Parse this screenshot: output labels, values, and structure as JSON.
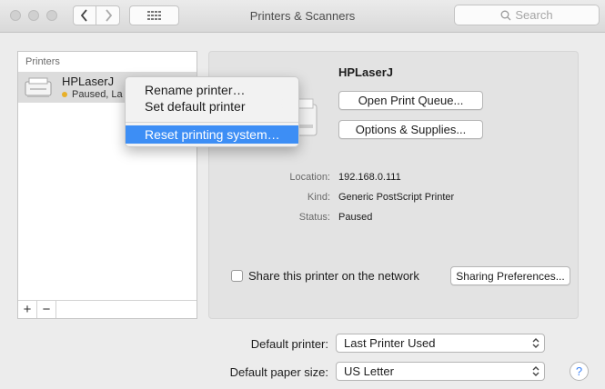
{
  "window": {
    "title": "Printers & Scanners",
    "search_placeholder": "Search"
  },
  "printers": {
    "header": "Printers",
    "items": [
      {
        "name": "HPLaserJ",
        "status": "Paused, La",
        "status_color": "#e8b028"
      }
    ],
    "add_label": "+",
    "remove_label": "−"
  },
  "context_menu": {
    "items": [
      {
        "label": "Rename printer…"
      },
      {
        "label": "Set default printer"
      },
      {
        "label": "Reset printing system…",
        "highlighted": true
      }
    ],
    "highlight_color": "#3d8ef5"
  },
  "detail": {
    "printer_name": "HPLaserJ",
    "open_queue_label": "Open Print Queue...",
    "options_label": "Options & Supplies...",
    "location_label": "Location:",
    "location_value": "192.168.0.111",
    "kind_label": "Kind:",
    "kind_value": "Generic PostScript Printer",
    "status_label": "Status:",
    "status_value": "Paused",
    "share_label": "Share this printer on the network",
    "share_checked": false,
    "sharing_prefs_label": "Sharing Preferences..."
  },
  "defaults": {
    "default_printer_label": "Default printer:",
    "default_printer_value": "Last Printer Used",
    "paper_size_label": "Default paper size:",
    "paper_size_value": "US Letter",
    "help_label": "?"
  }
}
